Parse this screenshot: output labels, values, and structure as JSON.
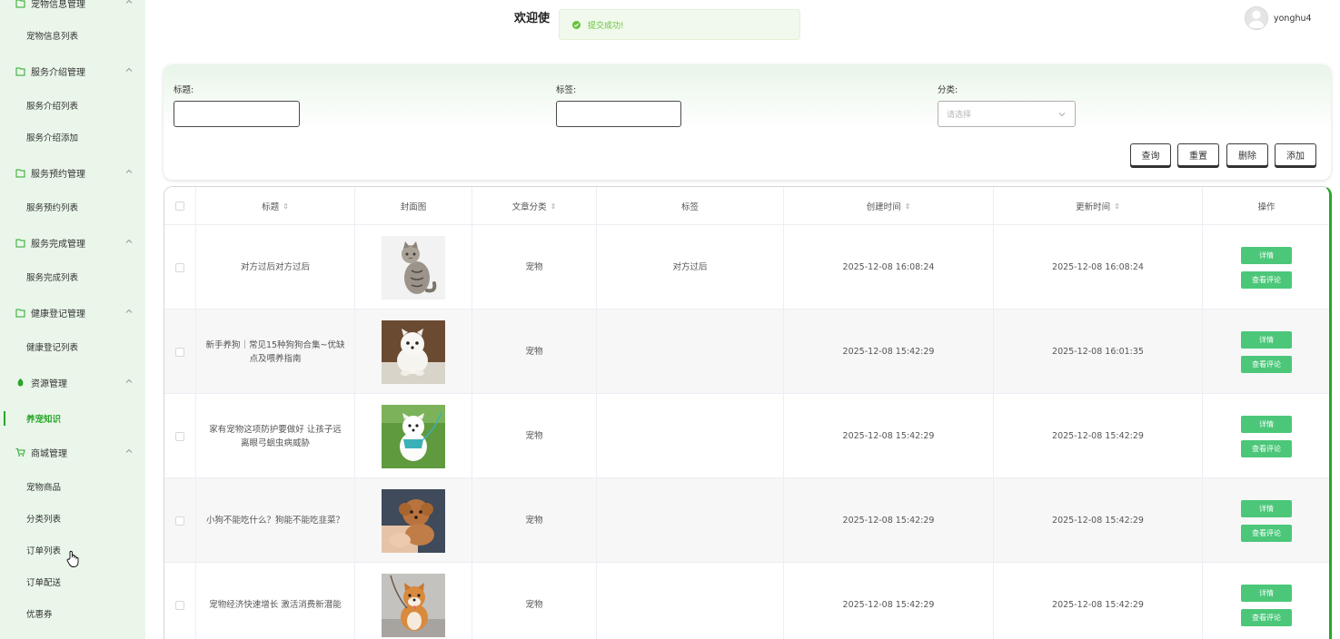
{
  "sidebar": {
    "groups": [
      {
        "label": "宠物信息管理",
        "icon": "folder-icon"
      },
      {
        "label": "服务介绍管理",
        "icon": "folder-icon"
      },
      {
        "label": "服务预约管理",
        "icon": "folder-icon"
      },
      {
        "label": "服务完成管理",
        "icon": "folder-icon"
      },
      {
        "label": "健康登记管理",
        "icon": "folder-icon"
      },
      {
        "label": "资源管理",
        "icon": "leaf-icon"
      },
      {
        "label": "商城管理",
        "icon": "cart-icon"
      }
    ],
    "items": {
      "pet_info_list": "宠物信息列表",
      "service_intro_list": "服务介绍列表",
      "service_intro_add": "服务介绍添加",
      "booking_list": "服务预约列表",
      "completion_list": "服务完成列表",
      "health_list": "健康登记列表",
      "pet_knowledge": "养宠知识",
      "pet_goods": "宠物商品",
      "category_list": "分类列表",
      "order_list": "订单列表",
      "order_delivery": "订单配送",
      "coupons": "优惠券"
    },
    "accent": "#2aa52a"
  },
  "header": {
    "welcome": "欢迎使",
    "toast": "提交成功!",
    "username": "yonghu4"
  },
  "search": {
    "title_label": "标题:",
    "tag_label": "标签:",
    "category_label": "分类:",
    "category_placeholder": "请选择",
    "buttons": {
      "query": "查询",
      "reset": "重置",
      "delete": "删除",
      "add": "添加"
    }
  },
  "table": {
    "headers": {
      "title": "标题",
      "cover": "封面图",
      "category": "文章分类",
      "tag": "标签",
      "created": "创建时间",
      "updated": "更新时间",
      "actions": "操作"
    },
    "sort_glyph": "⇕",
    "rows": [
      {
        "title": "对方过后对方过后",
        "category": "宠物",
        "tag": "对方过后",
        "created": "2025-12-08 16:08:24",
        "updated": "2025-12-08 16:08:24",
        "cover": "cat-photo"
      },
      {
        "title": "新手养狗｜常见15种狗狗合集~优缺点及喂养指南",
        "category": "宠物",
        "tag": "",
        "created": "2025-12-08 15:42:29",
        "updated": "2025-12-08 16:01:35",
        "cover": "pomeranian-photo"
      },
      {
        "title": "家有宠物这项防护要做好 让孩子远离眼弓蛔虫病威胁",
        "category": "宠物",
        "tag": "",
        "created": "2025-12-08 15:42:29",
        "updated": "2025-12-08 15:42:29",
        "cover": "white-dog-grass-photo"
      },
      {
        "title": "小狗不能吃什么？狗能不能吃韭菜？",
        "category": "宠物",
        "tag": "",
        "created": "2025-12-08 15:42:29",
        "updated": "2025-12-08 15:42:29",
        "cover": "poodle-photo"
      },
      {
        "title": "宠物经济快速增长 激活消费新潜能",
        "category": "宠物",
        "tag": "",
        "created": "2025-12-08 15:42:29",
        "updated": "2025-12-08 15:42:29",
        "cover": "shiba-photo"
      }
    ],
    "actions": {
      "detail": "详情",
      "comments": "查看评论"
    },
    "action_color": "#4cc77a"
  }
}
